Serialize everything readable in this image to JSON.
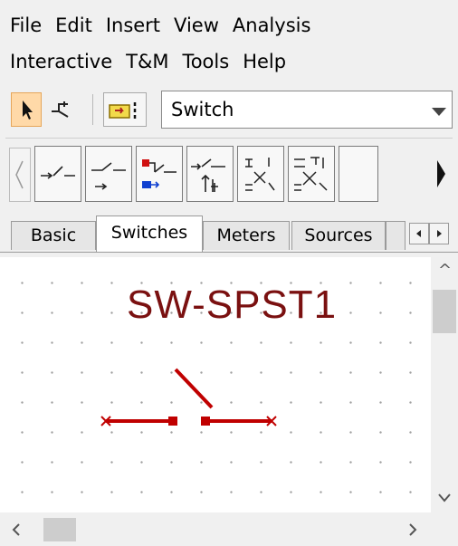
{
  "menu": {
    "row1": [
      "File",
      "Edit",
      "Insert",
      "View",
      "Analysis"
    ],
    "row2": [
      "Interactive",
      "T&M",
      "Tools",
      "Help"
    ]
  },
  "toolbar": {
    "combo_value": "Switch",
    "icons": [
      "pointer-icon",
      "wire-icon",
      "probe-icon",
      "chevron-down-icon"
    ]
  },
  "palette": {
    "components": [
      "spst-switch",
      "spdt-switch",
      "bus-switch",
      "time-delay-switch",
      "dual-switch",
      "multi-switch"
    ]
  },
  "tabs": [
    "Basic",
    "Switches",
    "Meters",
    "Sources"
  ],
  "active_tab": "Switches",
  "canvas": {
    "component_label": "SW-SPST1",
    "wire_color": "#c00000",
    "label_color": "#7a1010"
  }
}
